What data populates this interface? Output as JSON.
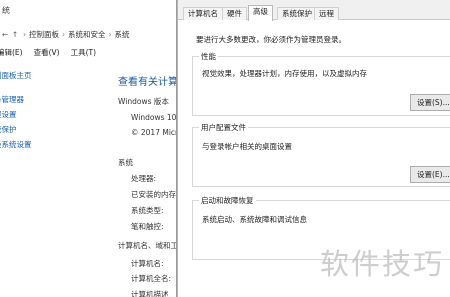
{
  "background_window": {
    "title": "统",
    "address": {
      "back": "←",
      "up": "↑",
      "path": [
        "控制面板",
        "系统和安全",
        "系统"
      ]
    },
    "menu": [
      "编辑(E)",
      "查看(V)",
      "工具(T)"
    ],
    "sidebar_links": [
      "制面板主页",
      "备管理器",
      "程设置",
      "统保护",
      "级系统设置"
    ],
    "main_title": "查看有关计算",
    "sections": {
      "windows_edition": "Windows 版本",
      "windows_name": "Windows 10",
      "copyright": "© 2017 Micr",
      "system": "系统",
      "processor": "处理器:",
      "installed_memory": "已安装的内存",
      "system_type": "系统类型:",
      "pen_touch": "笔和触控:",
      "computer_name_group": "计算机名、域和工",
      "computer_name": "计算机名:",
      "full_computer_name": "计算机全名:",
      "computer_description": "计算机描述"
    }
  },
  "dialog": {
    "tabs": [
      "计算机名",
      "硬件",
      "高级",
      "系统保护",
      "远程"
    ],
    "active_tab": "高级",
    "admin_note": "要进行大多数更改，你必须作为管理员登录。",
    "groups": [
      {
        "title": "性能",
        "description": "视觉效果，处理器计划，内存使用，以及虚拟内存",
        "button": "设置(S)..."
      },
      {
        "title": "用户配置文件",
        "description": "与登录帐户相关的桌面设置",
        "button": "设置(E)..."
      },
      {
        "title": "启动和故障恢复",
        "description": "系统启动、系统故障和调试信息",
        "button": ""
      }
    ]
  },
  "watermark": "软件技巧"
}
